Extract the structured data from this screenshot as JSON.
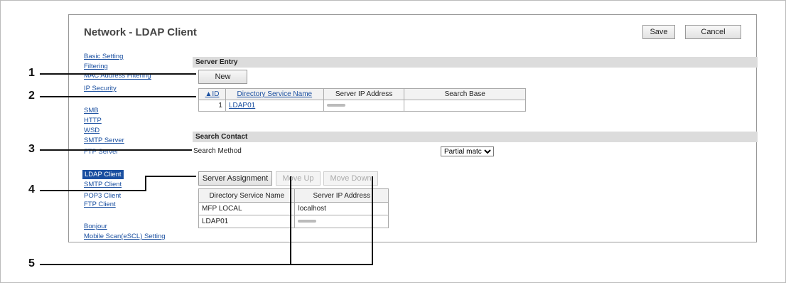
{
  "page": {
    "title": "Network - LDAP Client"
  },
  "toolbar": {
    "save_label": "Save",
    "cancel_label": "Cancel"
  },
  "nav": {
    "basic": "Basic Setting",
    "filtering": "Filtering",
    "hidden1": "MAC Address Filtering",
    "ipsec": "IP Security",
    "smb": "SMB",
    "http": "HTTP",
    "wsd": "WSD",
    "smtp_server": "SMTP Server",
    "hidden2": "FTP Server",
    "ldap_client": "LDAP Client",
    "smtp_client": "SMTP Client",
    "hidden3": "POP3 Client",
    "ftp_client": "FTP Client",
    "bonjour": "Bonjour",
    "mobile_scan": "Mobile Scan(eSCL) Setting"
  },
  "server_entry": {
    "header": "Server Entry",
    "new_label": "New",
    "columns": [
      "▲ID",
      "Directory Service Name",
      "Server IP Address",
      "Search Base"
    ],
    "rows": [
      {
        "id": "1",
        "name": "LDAP01",
        "search_base": ""
      }
    ]
  },
  "search_contact": {
    "header": "Search Contact",
    "method_label": "Search Method",
    "method_value": "Partial match"
  },
  "assignment": {
    "server_assignment_label": "Server Assignment",
    "move_up_label": "Move Up",
    "move_down_label": "Move Down",
    "columns": [
      "Directory Service Name",
      "Server IP Address"
    ],
    "rows": [
      {
        "name": "MFP LOCAL",
        "ip": "localhost"
      },
      {
        "name": "LDAP01",
        "ip": ""
      }
    ]
  },
  "callouts": [
    "1",
    "2",
    "3",
    "4",
    "5"
  ]
}
